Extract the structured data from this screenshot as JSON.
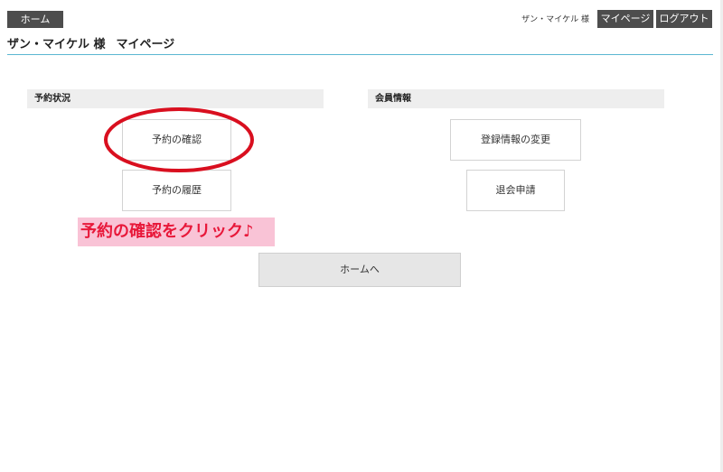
{
  "header": {
    "home_tab": "ホーム",
    "user_name": "ザン・マイケル 様",
    "page_name": "マイページ",
    "top_user_name": "ザン・マイケル 様",
    "mypage_button": "マイページ",
    "logout_button": "ログアウト"
  },
  "sections": {
    "reservation": {
      "title": "予約状況",
      "confirm_button": "予約の確認",
      "history_button": "予約の履歴"
    },
    "member": {
      "title": "会員情報",
      "change_button": "登録情報の変更",
      "withdraw_button": "退会申請"
    }
  },
  "annotation": {
    "text": "予約の確認をクリック♪"
  },
  "home_button": "ホームへ",
  "colors": {
    "dark_button": "#4d4d4d",
    "header_rule": "#5bb7d2",
    "annotation_text": "#e8183a",
    "annotation_bg": "#f9c3d6",
    "highlight_ellipse": "#d90f1f",
    "section_bar": "#eeeeee"
  }
}
